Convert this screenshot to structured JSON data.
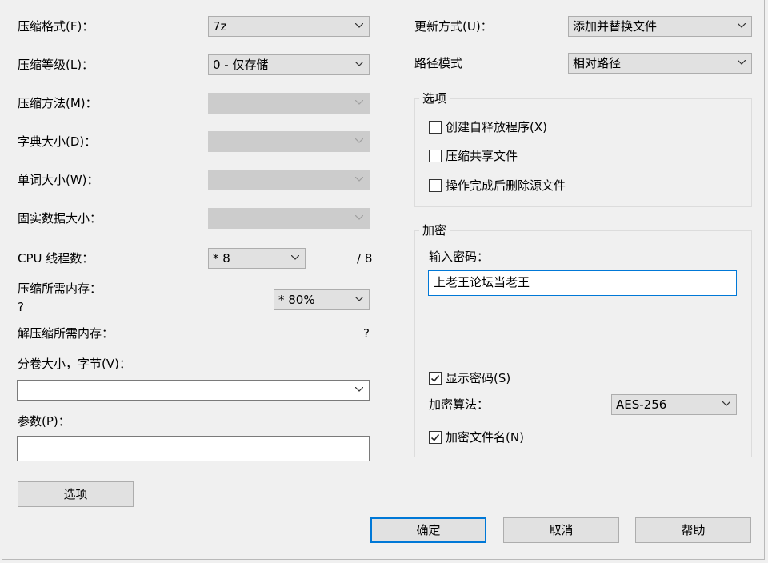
{
  "left": {
    "format_label": "压缩格式(F)：",
    "format_value": "7z",
    "level_label": "压缩等级(L)：",
    "level_value": "0 - 仅存储",
    "method_label": "压缩方法(M)：",
    "dict_label": "字典大小(D)：",
    "word_label": "单词大小(W)：",
    "solid_label": "固实数据大小：",
    "cpu_label": "CPU 线程数：",
    "cpu_value": "* 8",
    "cpu_max": "/ 8",
    "mem_comp_label": "压缩所需内存：",
    "mem_comp_value": "?",
    "mem_percent": "* 80%",
    "mem_decomp_label": "解压缩所需内存：",
    "mem_decomp_value": "?",
    "volume_label": "分卷大小，字节(V)：",
    "volume_value": "",
    "params_label": "参数(P)：",
    "params_value": "",
    "options_button": "选项"
  },
  "right": {
    "update_label": "更新方式(U)：",
    "update_value": "添加并替换文件",
    "path_label": "路径模式",
    "path_value": "相对路径",
    "options_group": "选项",
    "sfx_label": "创建自释放程序(X)",
    "sfx_checked": false,
    "shared_label": "压缩共享文件",
    "shared_checked": false,
    "delete_label": "操作完成后删除源文件",
    "delete_checked": false,
    "encrypt_group": "加密",
    "password_label": "输入密码：",
    "password_value": "上老王论坛当老王",
    "show_password_label": "显示密码(S)",
    "show_password_checked": true,
    "algo_label": "加密算法：",
    "algo_value": "AES-256",
    "encrypt_names_label": "加密文件名(N)",
    "encrypt_names_checked": true
  },
  "footer": {
    "ok": "确定",
    "cancel": "取消",
    "help": "帮助"
  }
}
